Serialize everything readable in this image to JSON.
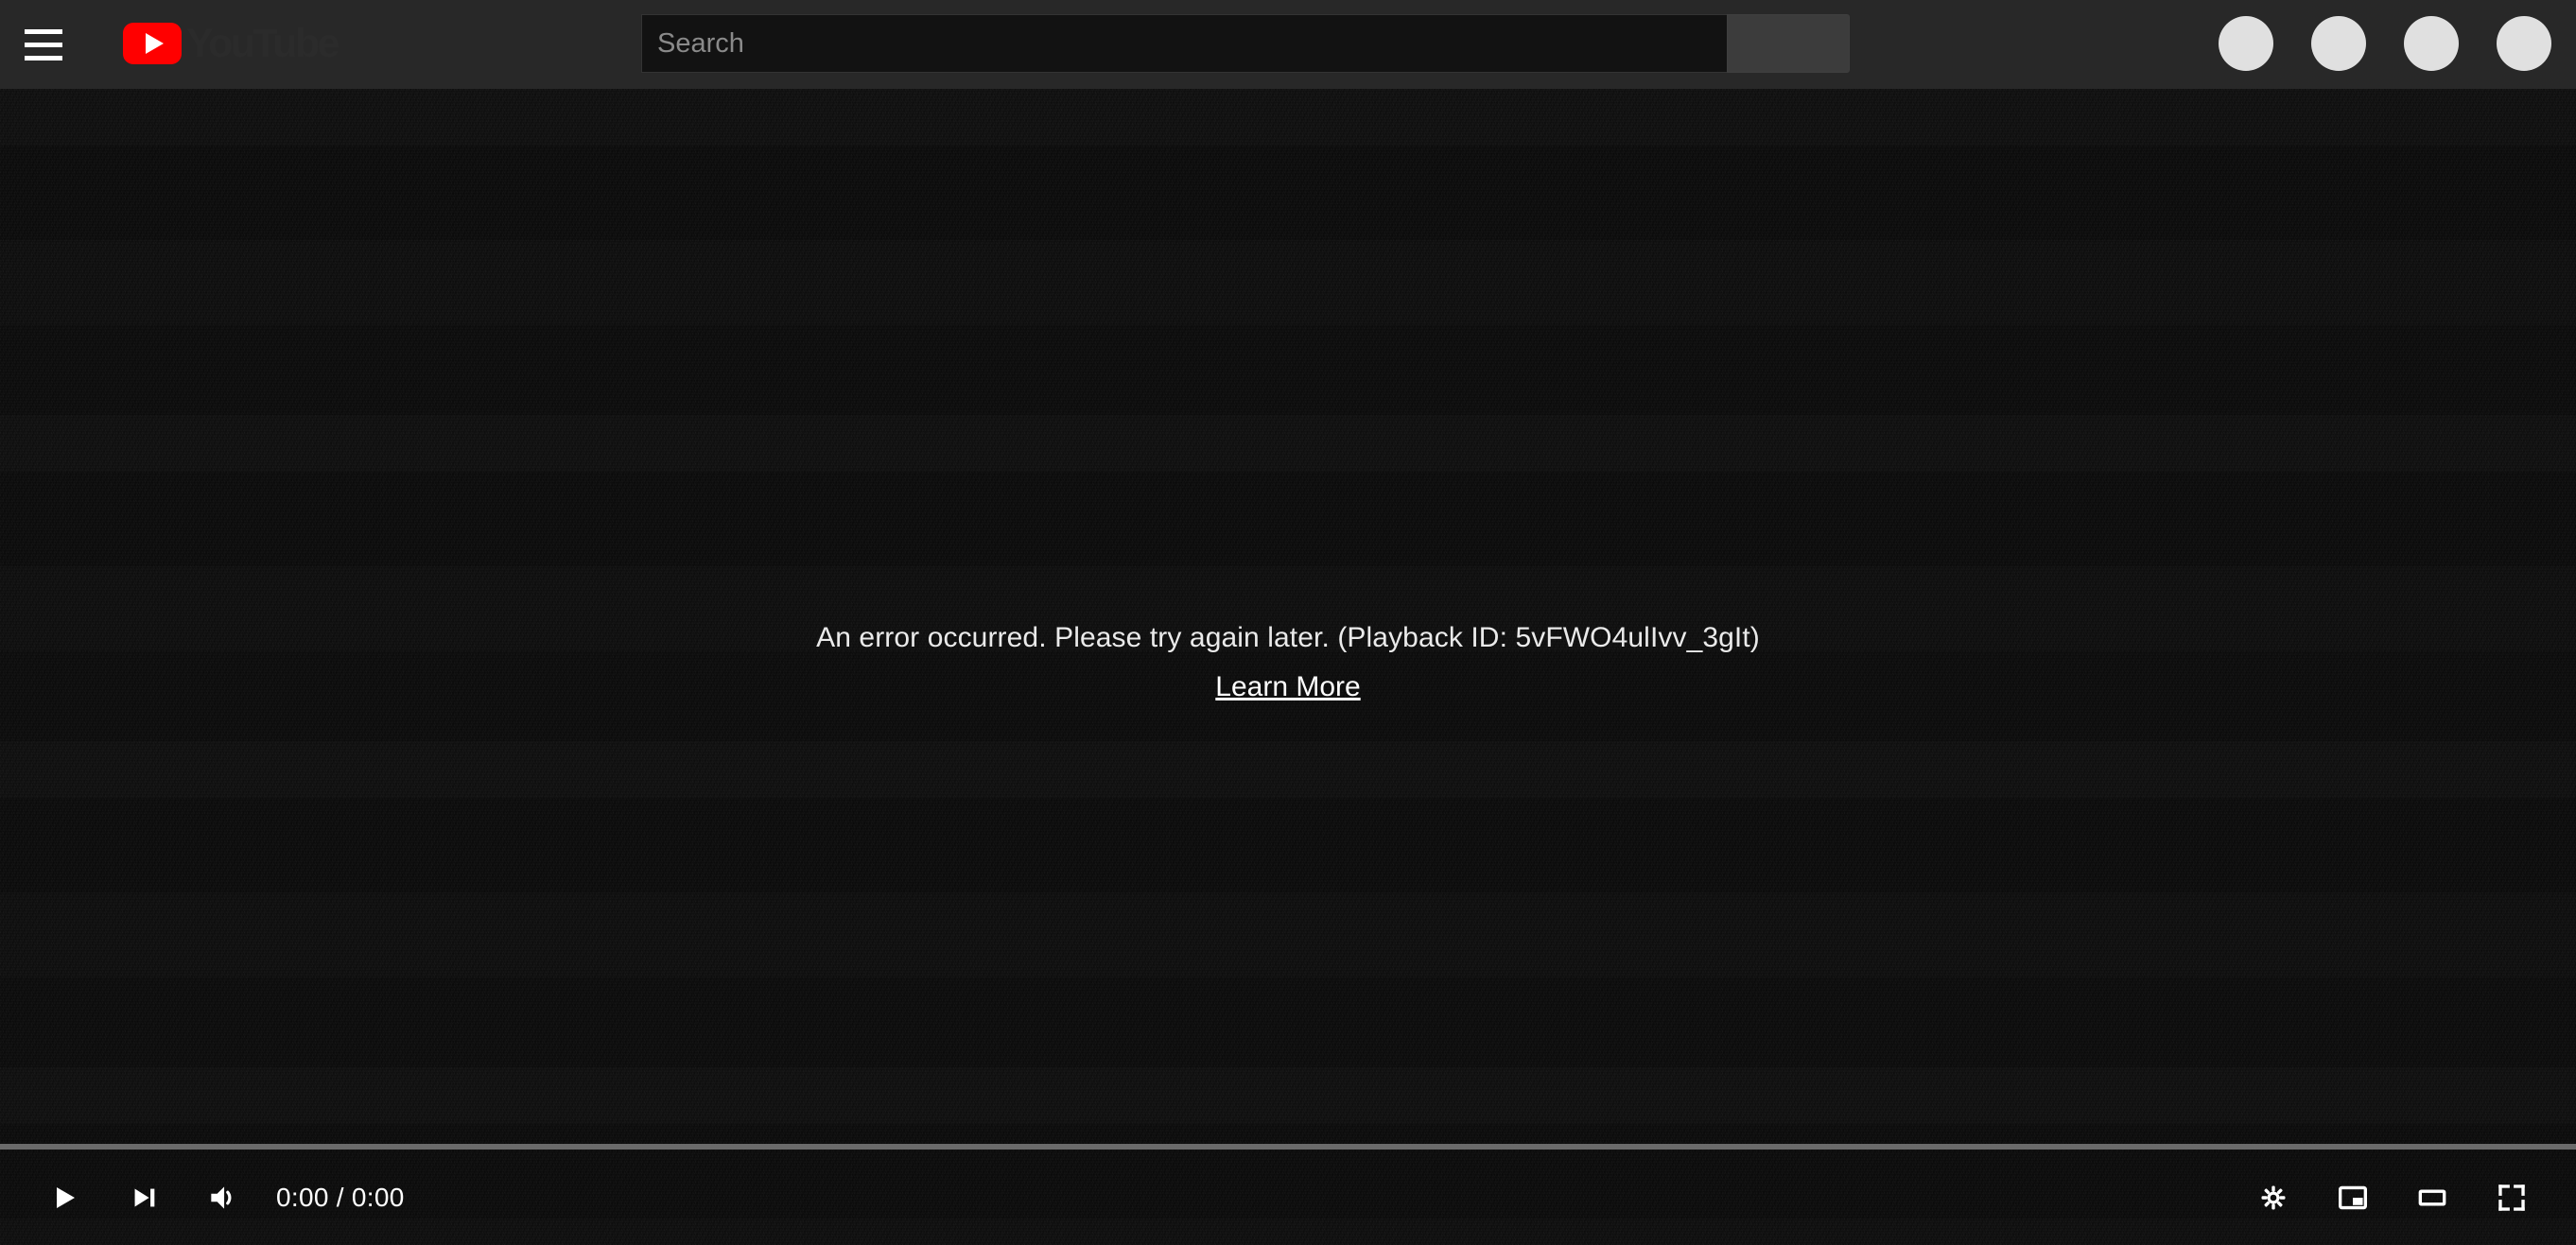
{
  "header": {
    "menu_label": "Guide",
    "logo_word": "YouTube",
    "search": {
      "placeholder": "Search",
      "value": "",
      "submit_label": ""
    },
    "actions": [
      {
        "name": "action-1",
        "label": ""
      },
      {
        "name": "action-2",
        "label": ""
      },
      {
        "name": "action-3",
        "label": ""
      },
      {
        "name": "action-4",
        "label": ""
      }
    ]
  },
  "player": {
    "error": {
      "message": "An error occurred. Please try again later. (Playback ID: 5vFWO4ulIvv_3gIt)",
      "playback_id": "5vFWO4ulIvv_3gIt",
      "link_label": "Learn More"
    },
    "controls": {
      "play_label": "Play",
      "next_label": "Next",
      "volume_label": "Mute",
      "time": "0:00 / 0:00",
      "current_time": "0:00",
      "duration": "0:00",
      "settings_label": "Settings",
      "miniplayer_label": "Miniplayer",
      "theater_label": "Theater mode",
      "fullscreen_label": "Full screen"
    },
    "progress_percent": 0
  },
  "colors": {
    "brand_red": "#ff0000",
    "header_bg": "#282828",
    "player_bg": "#0d0d0d",
    "search_bg": "#121212",
    "search_button_bg": "#3c3c3c",
    "avatar_fill": "#e0e0e0",
    "progress_track": "#6a6a6a"
  }
}
